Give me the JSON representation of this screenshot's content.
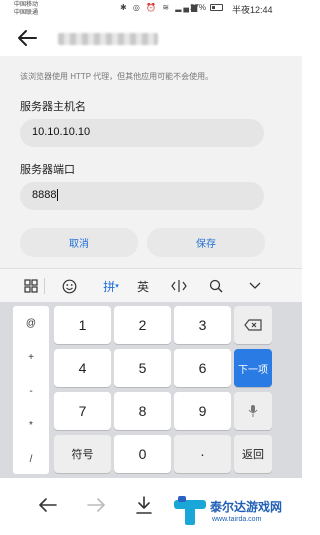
{
  "status_bar": {
    "carrier_1": "中国移动",
    "carrier_2": "中国联通",
    "battery": "27%",
    "time": "半夜12:44"
  },
  "app_bar": {
    "back_icon": "arrow-left-icon"
  },
  "form": {
    "notice": "该浏览器使用 HTTP 代理，但其他应用可能不会使用。",
    "host_label": "服务器主机名",
    "host_value": "10.10.10.10",
    "port_label": "服务器端口",
    "port_value": "8888",
    "cancel_label": "取消",
    "save_label": "保存",
    "accent_color": "#1f6fd6"
  },
  "ime_toolbar": {
    "items": [
      "grid-icon",
      "emoji-icon",
      "拼",
      "英",
      "cursor-icon",
      "search-icon",
      "chevron-down-icon"
    ],
    "pinyin_label": "拼",
    "english_label": "英"
  },
  "keyboard": {
    "side_keys": [
      "@",
      "+",
      "-",
      "*",
      "/"
    ],
    "rows": [
      [
        "1",
        "2",
        "3"
      ],
      [
        "4",
        "5",
        "6"
      ],
      [
        "7",
        "8",
        "9"
      ]
    ],
    "symbol_label": "符号",
    "zero_label": "0",
    "dot_label": "·",
    "next_label": "下一项",
    "return_label": "返回",
    "next_color": "#2b7be4"
  },
  "watermark": {
    "name": "泰尔达游戏网",
    "url": "www.tairda.com"
  }
}
